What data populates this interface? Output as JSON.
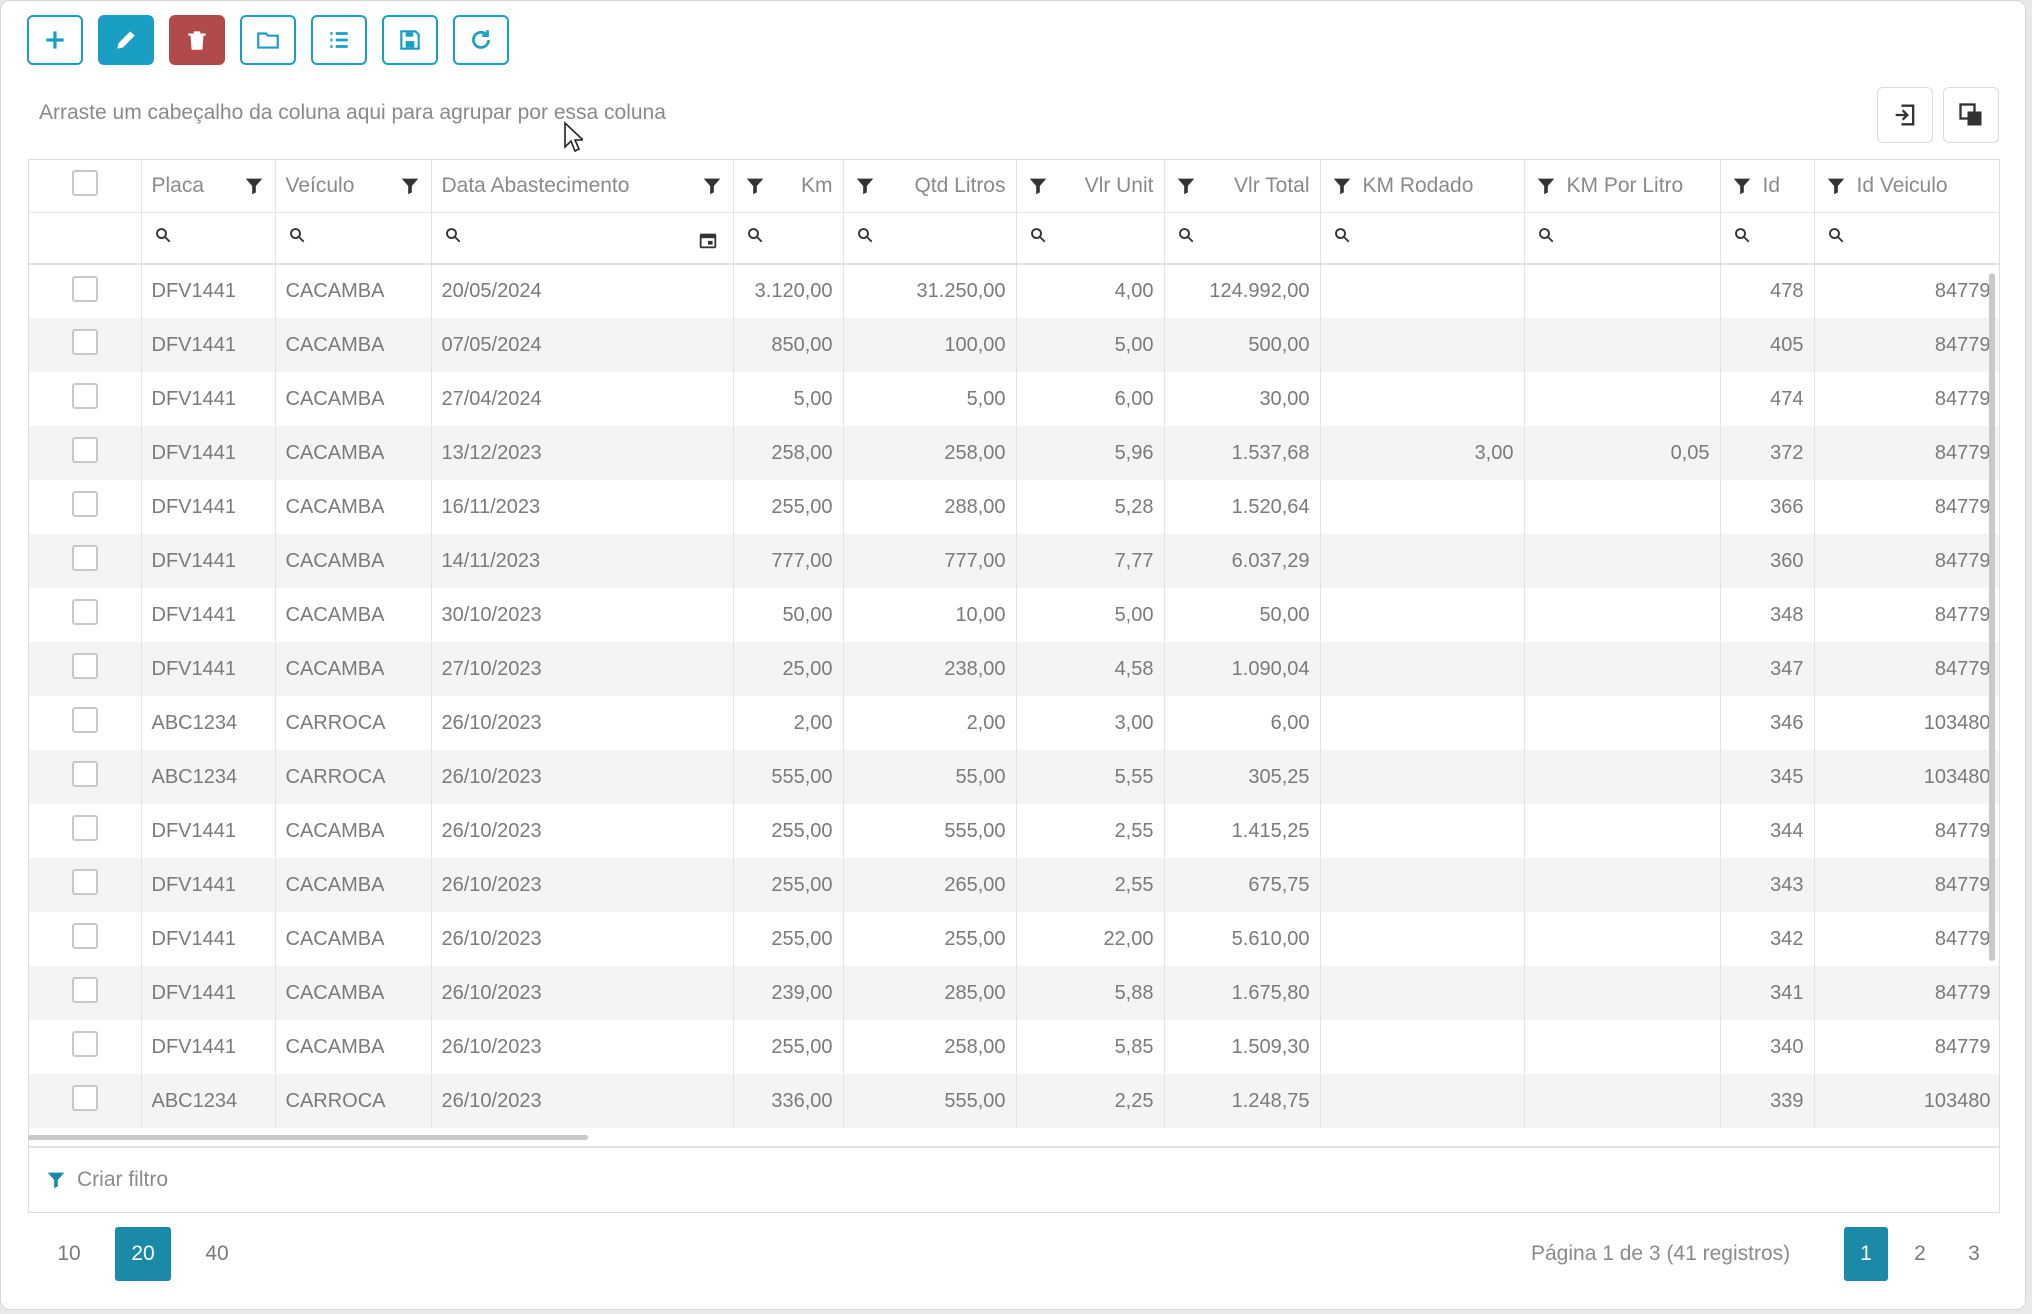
{
  "toolbar": {
    "buttons": [
      {
        "name": "add",
        "icon": "plus-icon"
      },
      {
        "name": "edit",
        "icon": "pencil-icon"
      },
      {
        "name": "delete",
        "icon": "trash-icon"
      },
      {
        "name": "open",
        "icon": "folder-open-icon"
      },
      {
        "name": "list",
        "icon": "list-icon"
      },
      {
        "name": "save",
        "icon": "save-icon"
      },
      {
        "name": "refresh",
        "icon": "refresh-icon"
      }
    ]
  },
  "group_hint": "Arraste um cabeçalho da coluna aqui para agrupar por essa coluna",
  "right_buttons": [
    {
      "name": "export",
      "icon": "export-icon"
    },
    {
      "name": "column-chooser",
      "icon": "column-chooser-icon"
    }
  ],
  "columns": [
    {
      "label": "Placa"
    },
    {
      "label": "Veículo"
    },
    {
      "label": "Data Abastecimento"
    },
    {
      "label": "Km"
    },
    {
      "label": "Qtd Litros"
    },
    {
      "label": "Vlr Unit"
    },
    {
      "label": "Vlr Total"
    },
    {
      "label": "KM Rodado"
    },
    {
      "label": "KM Por Litro"
    },
    {
      "label": "Id"
    },
    {
      "label": "Id Veiculo"
    }
  ],
  "rows": [
    [
      "DFV1441",
      "CACAMBA",
      "20/05/2024",
      "3.120,00",
      "31.250,00",
      "4,00",
      "124.992,00",
      "",
      "",
      "478",
      "84779"
    ],
    [
      "DFV1441",
      "CACAMBA",
      "07/05/2024",
      "850,00",
      "100,00",
      "5,00",
      "500,00",
      "",
      "",
      "405",
      "84779"
    ],
    [
      "DFV1441",
      "CACAMBA",
      "27/04/2024",
      "5,00",
      "5,00",
      "6,00",
      "30,00",
      "",
      "",
      "474",
      "84779"
    ],
    [
      "DFV1441",
      "CACAMBA",
      "13/12/2023",
      "258,00",
      "258,00",
      "5,96",
      "1.537,68",
      "3,00",
      "0,05",
      "372",
      "84779"
    ],
    [
      "DFV1441",
      "CACAMBA",
      "16/11/2023",
      "255,00",
      "288,00",
      "5,28",
      "1.520,64",
      "",
      "",
      "366",
      "84779"
    ],
    [
      "DFV1441",
      "CACAMBA",
      "14/11/2023",
      "777,00",
      "777,00",
      "7,77",
      "6.037,29",
      "",
      "",
      "360",
      "84779"
    ],
    [
      "DFV1441",
      "CACAMBA",
      "30/10/2023",
      "50,00",
      "10,00",
      "5,00",
      "50,00",
      "",
      "",
      "348",
      "84779"
    ],
    [
      "DFV1441",
      "CACAMBA",
      "27/10/2023",
      "25,00",
      "238,00",
      "4,58",
      "1.090,04",
      "",
      "",
      "347",
      "84779"
    ],
    [
      "ABC1234",
      "CARROCA",
      "26/10/2023",
      "2,00",
      "2,00",
      "3,00",
      "6,00",
      "",
      "",
      "346",
      "103480"
    ],
    [
      "ABC1234",
      "CARROCA",
      "26/10/2023",
      "555,00",
      "55,00",
      "5,55",
      "305,25",
      "",
      "",
      "345",
      "103480"
    ],
    [
      "DFV1441",
      "CACAMBA",
      "26/10/2023",
      "255,00",
      "555,00",
      "2,55",
      "1.415,25",
      "",
      "",
      "344",
      "84779"
    ],
    [
      "DFV1441",
      "CACAMBA",
      "26/10/2023",
      "255,00",
      "265,00",
      "2,55",
      "675,75",
      "",
      "",
      "343",
      "84779"
    ],
    [
      "DFV1441",
      "CACAMBA",
      "26/10/2023",
      "255,00",
      "255,00",
      "22,00",
      "5.610,00",
      "",
      "",
      "342",
      "84779"
    ],
    [
      "DFV1441",
      "CACAMBA",
      "26/10/2023",
      "239,00",
      "285,00",
      "5,88",
      "1.675,80",
      "",
      "",
      "341",
      "84779"
    ],
    [
      "DFV1441",
      "CACAMBA",
      "26/10/2023",
      "255,00",
      "258,00",
      "5,85",
      "1.509,30",
      "",
      "",
      "340",
      "84779"
    ],
    [
      "ABC1234",
      "CARROCA",
      "26/10/2023",
      "336,00",
      "555,00",
      "2,25",
      "1.248,75",
      "",
      "",
      "339",
      "103480"
    ]
  ],
  "filter_bar": {
    "label": "Criar filtro"
  },
  "pager": {
    "sizes": [
      "10",
      "20",
      "40"
    ],
    "active_size": "20",
    "info": "Página 1 de 3 (41 registros)",
    "pages": [
      "1",
      "2",
      "3"
    ],
    "active_page": "1"
  },
  "colors": {
    "accent": "#1a9fc4",
    "danger": "#b14a4a",
    "active_page": "#1a8aa8"
  }
}
